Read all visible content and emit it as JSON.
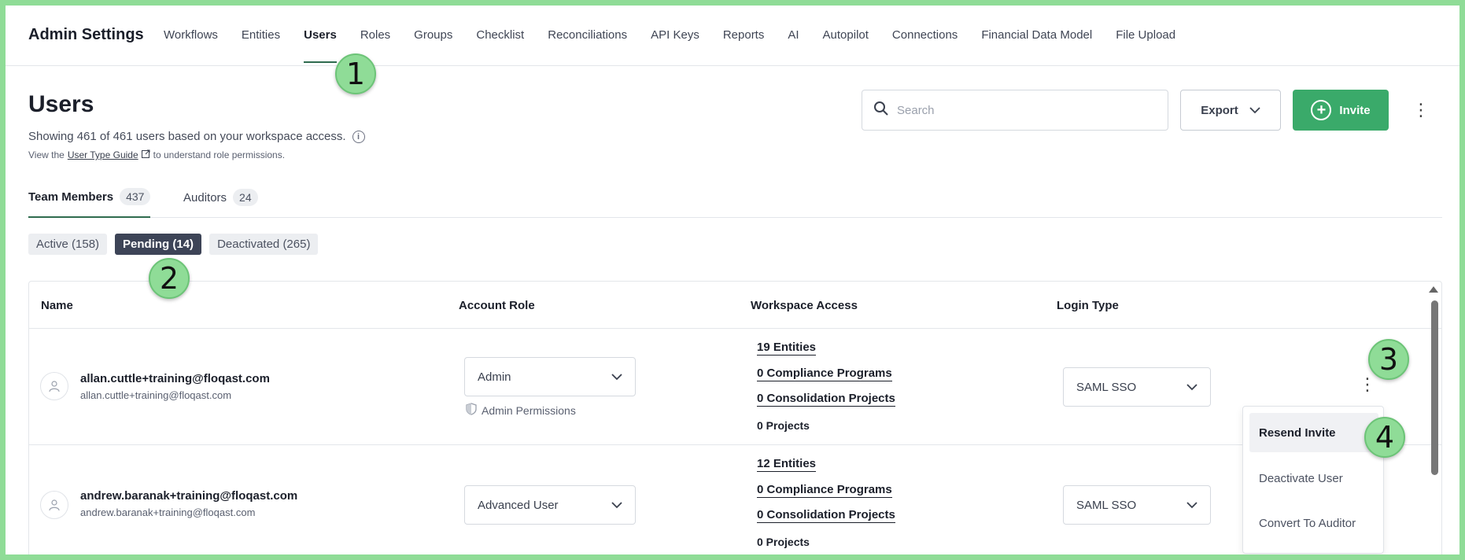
{
  "header": {
    "title": "Admin Settings",
    "nav": [
      "Workflows",
      "Entities",
      "Users",
      "Roles",
      "Groups",
      "Checklist",
      "Reconciliations",
      "API Keys",
      "Reports",
      "AI",
      "Autopilot",
      "Connections",
      "Financial Data Model",
      "File Upload"
    ],
    "active_nav": "Users"
  },
  "markers": [
    "1",
    "2",
    "3",
    "4"
  ],
  "page": {
    "title": "Users",
    "subtitle": "Showing 461 of 461 users based on your workspace access.",
    "guide_prefix": "View the",
    "guide_link": "User Type Guide",
    "guide_suffix": "to understand role permissions."
  },
  "toolbar": {
    "search_placeholder": "Search",
    "export_label": "Export",
    "invite_label": "Invite"
  },
  "tabs": [
    {
      "label": "Team Members",
      "count": "437"
    },
    {
      "label": "Auditors",
      "count": "24"
    }
  ],
  "filters": [
    "Active (158)",
    "Pending (14)",
    "Deactivated (265)"
  ],
  "selected_filter": "Pending (14)",
  "table": {
    "columns": [
      "Name",
      "Account Role",
      "Workspace Access",
      "Login Type"
    ],
    "rows": [
      {
        "name": "allan.cuttle+training@floqast.com",
        "email": "allan.cuttle+training@floqast.com",
        "role": "Admin",
        "role_note": "Admin Permissions",
        "entities": "19 Entities",
        "compliance": "0 Compliance Programs",
        "consolidation": "0 Consolidation Projects",
        "projects": "0 Projects",
        "login": "SAML SSO"
      },
      {
        "name": "andrew.baranak+training@floqast.com",
        "email": "andrew.baranak+training@floqast.com",
        "role": "Advanced User",
        "entities": "12 Entities",
        "compliance": "0 Compliance Programs",
        "consolidation": "0 Consolidation Projects",
        "projects": "0 Projects",
        "login": "SAML SSO"
      }
    ]
  },
  "row_menu": [
    "Resend Invite",
    "Deactivate User",
    "Convert To Auditor"
  ]
}
